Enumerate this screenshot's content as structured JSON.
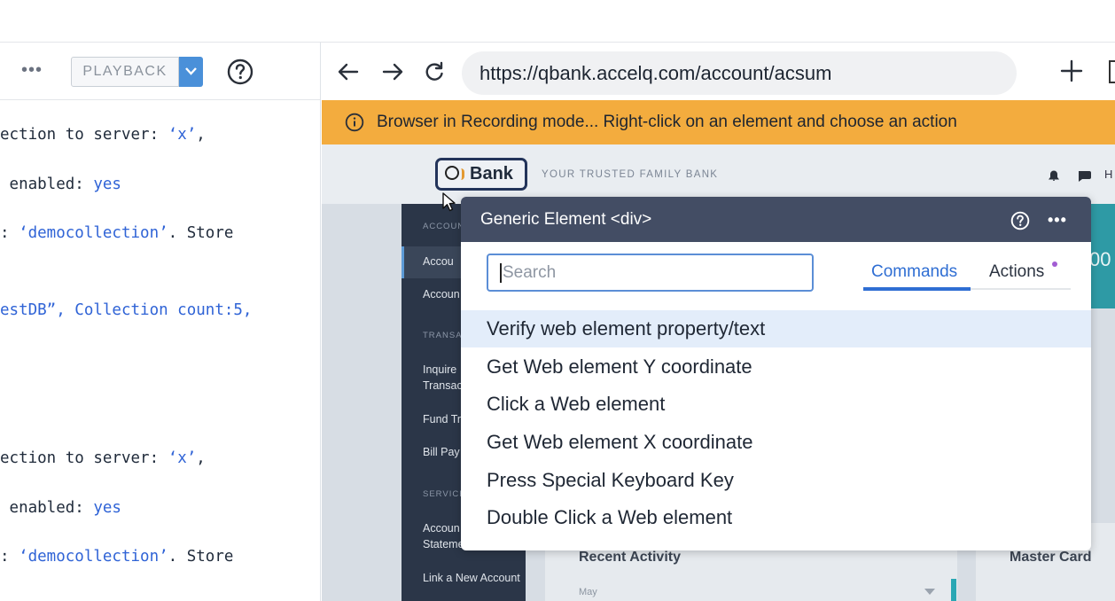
{
  "left_panel": {
    "more_label": "•••",
    "playback_label": "PLAYBACK",
    "code_lines": [
      {
        "plain": "ection to server: ",
        "value": "‘x’",
        "tail": ","
      },
      {
        "plain": " enabled: ",
        "value": "yes",
        "tail": ""
      },
      {
        "plain": ": ",
        "value": "‘democollection’",
        "tail": ". Store"
      },
      {
        "plain": "",
        "value": "estDB”, Collection count:5,",
        "tail": ""
      },
      {
        "plain": "ection to server: ",
        "value": "‘x’",
        "tail": ","
      },
      {
        "plain": " enabled: ",
        "value": "yes",
        "tail": ""
      },
      {
        "plain": ": ",
        "value": "‘democollection’",
        "tail": ". Store"
      }
    ]
  },
  "browser": {
    "url": "https://qbank.accelq.com/account/acsum",
    "banner_text": "Browser in Recording mode... Right-click on an element and choose an action"
  },
  "bank_page": {
    "logo_text": "Bank",
    "tagline": "YOUR TRUSTED FAMILY BANK",
    "header_right": "H",
    "sidenav": {
      "section_accounts": "ACCOUN",
      "item_account_summary": "Accou",
      "item_account": "Accoun",
      "section_transactions": "TRANSA",
      "item_inquire_1": "Inquire",
      "item_inquire_2": "Transac",
      "item_fund": "Fund Tr",
      "item_bill": "Bill Pay",
      "section_services": "SERVICE",
      "item_statements_1": "Accoun",
      "item_statements_2": "Stateme",
      "item_link": "Link a New Account"
    },
    "card_recent": "Recent Activity",
    "card_recent_month": "May",
    "card_master": "Master Card",
    "teal_value": "00"
  },
  "popup": {
    "title": "Generic Element <div>",
    "search_placeholder": "Search",
    "tab_commands": "Commands",
    "tab_actions": "Actions",
    "commands": [
      "Verify web element property/text",
      "Get Web element Y coordinate",
      "Click a Web element",
      "Get Web element X coordinate",
      "Press Special Keyboard Key",
      "Double Click a Web element"
    ]
  }
}
